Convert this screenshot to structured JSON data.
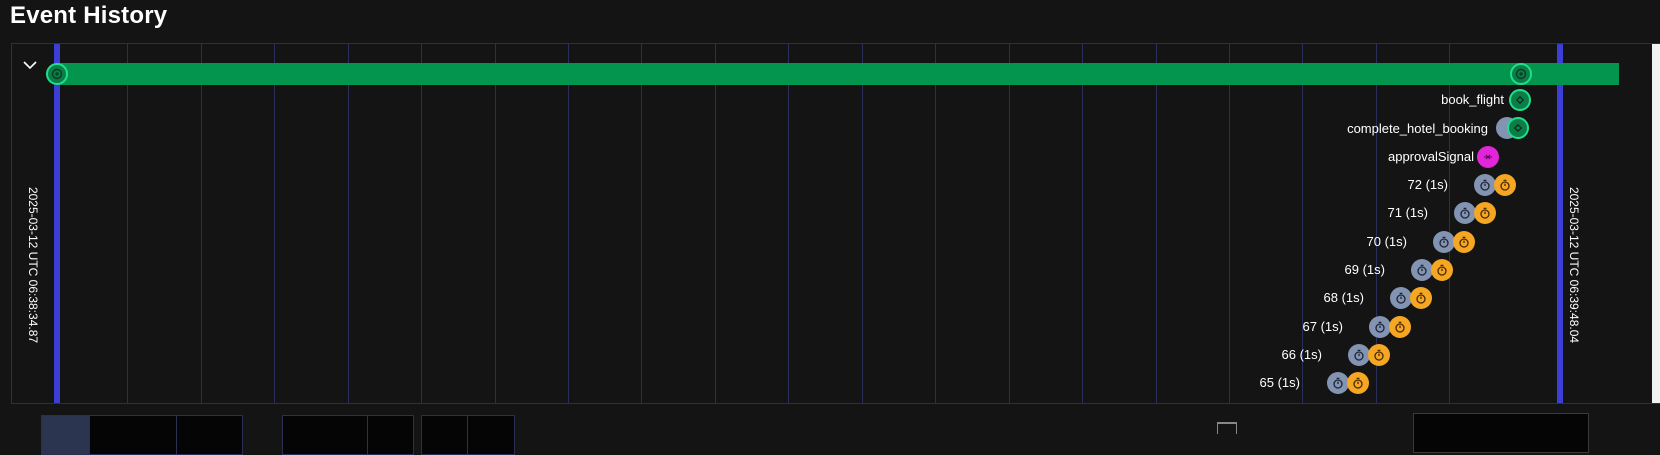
{
  "page": {
    "title": "Event History"
  },
  "timeline": {
    "start_label": "2025-03-12 UTC 06:38:34.87",
    "end_label": "2025-03-12 UTC 06:39:48.04",
    "events": [
      {
        "label": "book_flight",
        "icon": "activity-icon",
        "color": "#1ec87a"
      },
      {
        "label": "complete_hotel_booking",
        "icon": "activity-icon",
        "color": "#1ec87a"
      },
      {
        "label": "approvalSignal",
        "icon": "signal-icon",
        "color": "#e026d8"
      },
      {
        "label": "72 (1s)",
        "icon": "timer-icon",
        "color": "#f5a623"
      },
      {
        "label": "71 (1s)",
        "icon": "timer-icon",
        "color": "#f5a623"
      },
      {
        "label": "70 (1s)",
        "icon": "timer-icon",
        "color": "#f5a623"
      },
      {
        "label": "69 (1s)",
        "icon": "timer-icon",
        "color": "#f5a623"
      },
      {
        "label": "68 (1s)",
        "icon": "timer-icon",
        "color": "#f5a623"
      },
      {
        "label": "67 (1s)",
        "icon": "timer-icon",
        "color": "#f5a623"
      },
      {
        "label": "66 (1s)",
        "icon": "timer-icon",
        "color": "#f5a623"
      },
      {
        "label": "65 (1s)",
        "icon": "timer-icon",
        "color": "#f5a623"
      }
    ]
  },
  "colors": {
    "workflow_bar": "#03944e",
    "boundary": "#3c3fd6",
    "grid": "#2a2e5c",
    "timer_pending": "#8394b2",
    "timer_fired": "#f5a623",
    "signal": "#e026d8"
  }
}
